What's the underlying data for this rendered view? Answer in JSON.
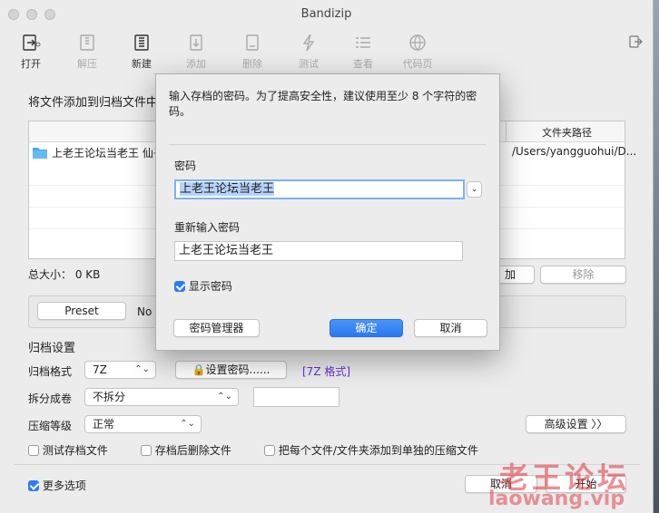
{
  "window": {
    "title": "Bandizip"
  },
  "toolbar": {
    "items": [
      {
        "label": "打开",
        "icon": "open-archive-icon",
        "enabled": true
      },
      {
        "label": "解压",
        "icon": "extract-icon",
        "enabled": false
      },
      {
        "label": "新建",
        "icon": "new-archive-icon",
        "enabled": true
      },
      {
        "label": "添加",
        "icon": "add-file-icon",
        "enabled": false
      },
      {
        "label": "删除",
        "icon": "delete-file-icon",
        "enabled": false
      },
      {
        "label": "测试",
        "icon": "test-icon",
        "enabled": false
      },
      {
        "label": "查看",
        "icon": "view-icon",
        "enabled": false
      },
      {
        "label": "代码页",
        "icon": "globe-icon",
        "enabled": false
      }
    ]
  },
  "main": {
    "instruction": "将文件添加到归档文件中",
    "table": {
      "columns": [
        "文件夹路径"
      ],
      "rows": [
        {
          "name": "上老王论坛当老王 仙子",
          "path": "/Users/yangguohui/D..."
        }
      ]
    },
    "total_size_label": "总大小：",
    "total_size_value": "0 KB",
    "add_button": "加",
    "remove_button": "移除",
    "preset_button": "Preset",
    "preset_value": "No",
    "archive_settings_title": "归档设置",
    "format_label": "归档格式",
    "format_value": "7Z",
    "set_password_button": "设置密码......",
    "format_tag": "[7Z 格式]",
    "split_label": "拆分成卷",
    "split_value": "不拆分",
    "split_size_value": "",
    "compression_label": "压缩等级",
    "compression_value": "正常",
    "advanced_button": "高级设置",
    "test_archive_label": "测试存档文件",
    "delete_after_label": "存档后删除文件",
    "each_separate_label": "把每个文件/文件夹添加到单独的压缩文件",
    "more_options_label": "更多选项",
    "cancel_button": "取消",
    "start_button": "开始"
  },
  "dialog": {
    "message": "输入存档的密码。为了提高安全性，建议使用至少 8 个字符的密码。",
    "password_label": "密码",
    "password_value": "上老王论坛当老王",
    "reenter_label": "重新输入密码",
    "reenter_value": "上老王论坛当老王",
    "show_password_label": "显示密码",
    "show_password_checked": true,
    "password_manager_button": "密码管理器",
    "ok_button": "确定",
    "cancel_button": "取消"
  },
  "desktop": {
    "watermark_line1": "老王论坛",
    "watermark_line2": "laowang.vip"
  },
  "colors": {
    "accent": "#2d7bf4",
    "format_tag": "#6a32d8",
    "watermark": "#e0323c"
  }
}
